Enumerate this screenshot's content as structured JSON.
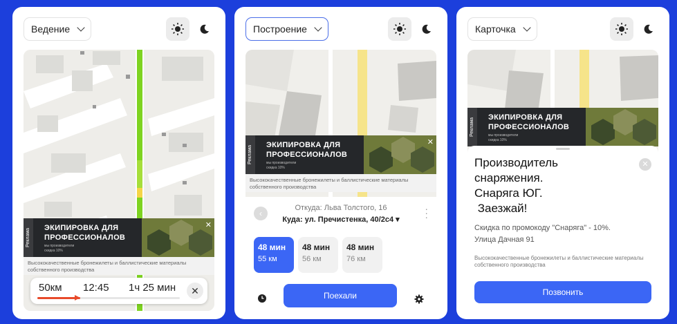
{
  "panels": [
    {
      "mode": "Ведение",
      "ad": {
        "tag": "Реклама",
        "title_line1": "ЭКИПИРОВКА ДЛЯ",
        "title_line2": "ПРОФЕССИОНАЛОВ",
        "subtitle1": "мы производители",
        "subtitle2": "скидка 10%",
        "description": "Высококачественные бронежилеты и баллистические материалы собственного производства"
      },
      "navbar": {
        "distance": "50км",
        "arrival": "12:45",
        "duration": "1ч 25 мин",
        "progress": 0.3
      }
    },
    {
      "mode": "Построение",
      "ad": {
        "tag": "Реклама",
        "title_line1": "ЭКИПИРОВКА ДЛЯ",
        "title_line2": "ПРОФЕССИОНАЛОВ",
        "subtitle1": "мы производители",
        "subtitle2": "скидка 10%",
        "description": "Высококачественные бронежилеты и баллистические материалы собственного производства"
      },
      "route": {
        "from": "Откуда: Льва Толстого, 16",
        "to": "Куда: ул. Пречистенка, 40/2с4 ▾",
        "options": [
          {
            "time": "48 мин",
            "distance": "55 км",
            "selected": true
          },
          {
            "time": "48 мин",
            "distance": "56 км",
            "selected": false
          },
          {
            "time": "48 мин",
            "distance": "76 км",
            "selected": false
          }
        ],
        "go_label": "Поехали"
      }
    },
    {
      "mode": "Карточка",
      "ad": {
        "tag": "Реклама",
        "title_line1": "ЭКИПИРОВКА ДЛЯ",
        "title_line2": "ПРОФЕССИОНАЛОВ",
        "subtitle1": "мы производители",
        "subtitle2": "скидка 10%",
        "description": ""
      },
      "card": {
        "title": "Производитель\nснаряжения.\nСнаряга ЮГ.\n Заезжай!",
        "promo": "Скидка по промокоду \"Снаряга\" - 10%.",
        "address": "Улица Дачная 91",
        "description": "Высококачественные бронежилеты и баллистические материалы собственного производства",
        "call_label": "Позвонить"
      }
    }
  ],
  "colors": {
    "background": "#1c3fdc",
    "accent": "#3b66f5",
    "route_green": "#7ed321",
    "route_yellow": "#f5d547",
    "route_red": "#e84a2a"
  },
  "icons": {
    "theme_light": "sun-icon",
    "theme_dark": "moon-icon",
    "close": "close-icon",
    "clock": "clock-icon",
    "settings": "gear-icon",
    "back": "chevron-left-icon",
    "more": "more-vertical-icon"
  }
}
